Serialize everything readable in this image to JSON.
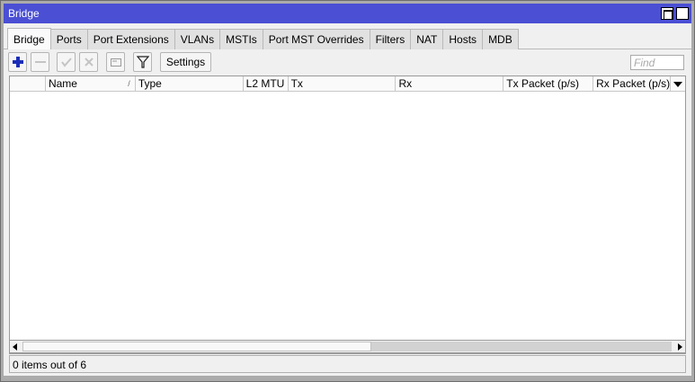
{
  "window": {
    "title": "Bridge"
  },
  "tabs": [
    {
      "label": "Bridge",
      "active": true
    },
    {
      "label": "Ports"
    },
    {
      "label": "Port Extensions"
    },
    {
      "label": "VLANs"
    },
    {
      "label": "MSTIs"
    },
    {
      "label": "Port MST Overrides"
    },
    {
      "label": "Filters"
    },
    {
      "label": "NAT"
    },
    {
      "label": "Hosts"
    },
    {
      "label": "MDB"
    }
  ],
  "toolbar": {
    "settings_label": "Settings",
    "find_placeholder": "Find",
    "accent": "#1a2db8"
  },
  "table": {
    "columns": [
      "Name",
      "Type",
      "L2 MTU",
      "Tx",
      "Rx",
      "Tx Packet (p/s)",
      "Rx Packet (p/s)"
    ],
    "sort_glyph": "/"
  },
  "status": {
    "text": "0 items out of 6"
  },
  "colors": {
    "titlebar": "#4a4fd4"
  }
}
